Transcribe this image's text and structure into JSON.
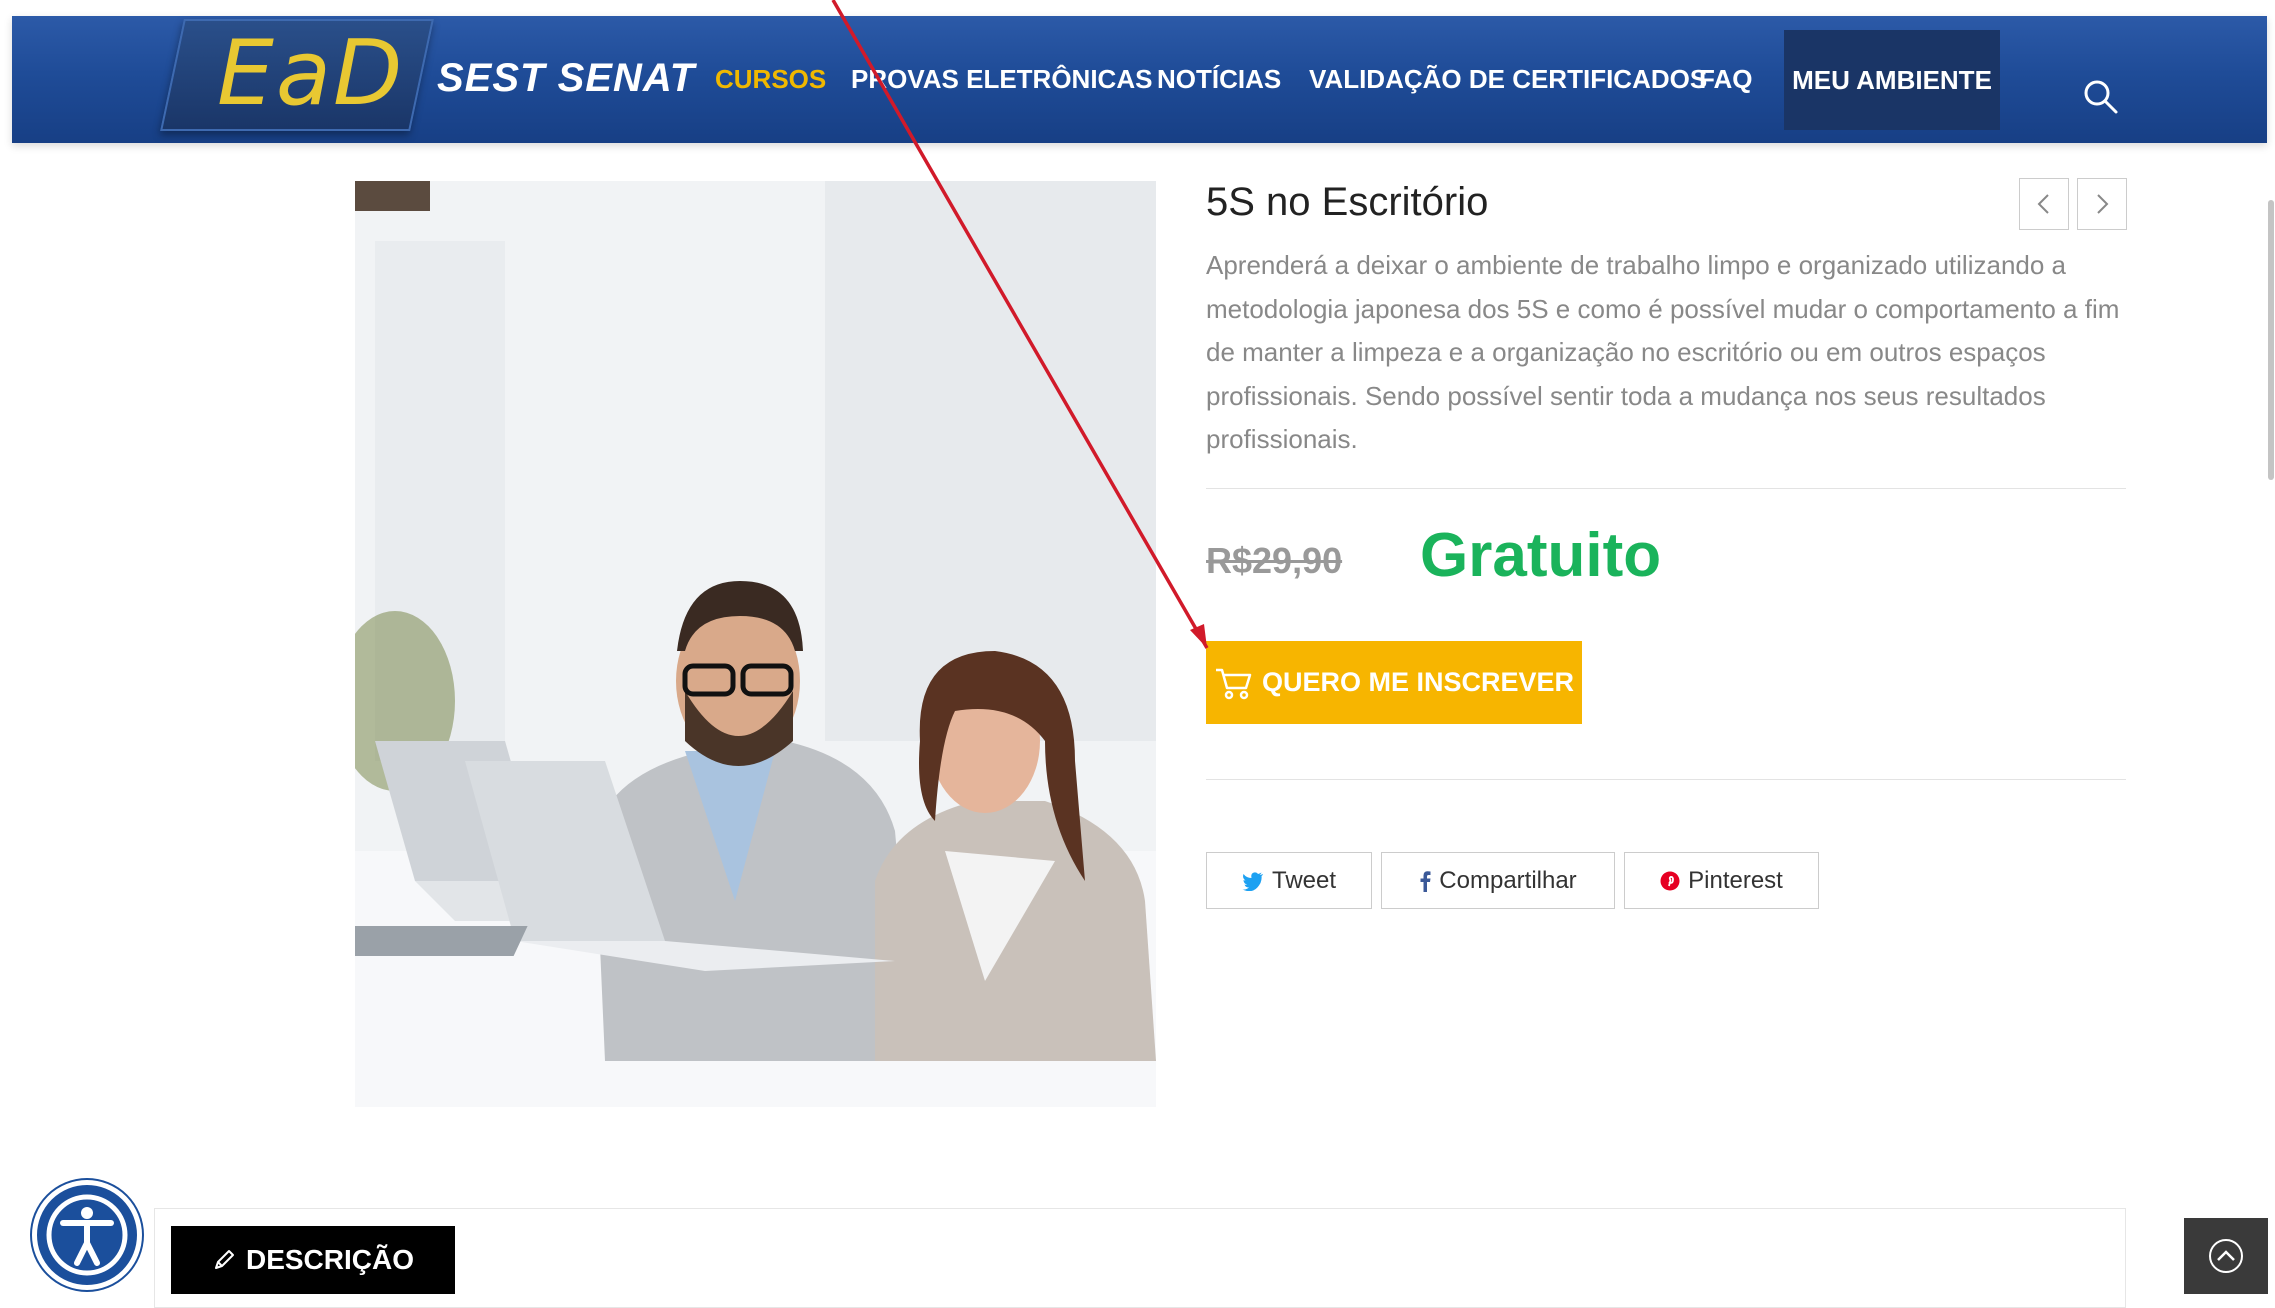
{
  "header": {
    "logo": "EaD",
    "brand": "SEST SENAT",
    "nav": [
      "CURSOS",
      "PROVAS ELETRÔNICAS",
      "NOTÍCIAS",
      "VALIDAÇÃO DE CERTIFICADOS",
      "FAQ"
    ],
    "account": "MEU AMBIENTE",
    "search_icon": "search-icon"
  },
  "product": {
    "title": "5S no Escritório",
    "description": "Aprenderá a deixar o ambiente de trabalho limpo e organizado utilizando a metodologia japonesa dos 5S e como é possível mudar o comportamento a fim de manter a limpeza e a organização no escritório ou em outros espaços profissionais. Sendo possível sentir toda a mudança nos seus resultados profissionais.",
    "old_price": "R$29,90",
    "price": "Gratuito",
    "cta": "QUERO ME INSCREVER"
  },
  "share": {
    "tweet": "Tweet",
    "facebook": "Compartilhar",
    "pinterest": "Pinterest"
  },
  "tabs": {
    "description": "DESCRIÇÃO"
  },
  "colors": {
    "header_blue": "#1f4c98",
    "accent_yellow": "#f7b500",
    "price_green": "#1ab35b",
    "annotation_red": "#d11a2a"
  }
}
